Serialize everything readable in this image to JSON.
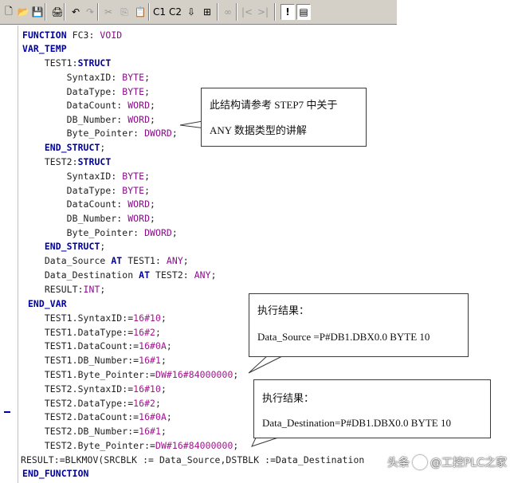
{
  "toolbar": {
    "buttons": [
      {
        "icon": "new-document-icon",
        "glyph": "🗋"
      },
      {
        "icon": "open-folder-icon",
        "glyph": "📂"
      },
      {
        "icon": "save-icon",
        "glyph": "💾"
      },
      {
        "icon": "print-icon",
        "glyph": "🖨"
      },
      {
        "icon": "undo-icon",
        "glyph": "↶"
      },
      {
        "icon": "redo-icon",
        "glyph": "↷"
      },
      {
        "icon": "cut-icon",
        "glyph": "✂"
      },
      {
        "icon": "copy-icon",
        "glyph": "⎘"
      },
      {
        "icon": "paste-icon",
        "glyph": "📋"
      },
      {
        "icon": "compile-icon",
        "glyph": "C1"
      },
      {
        "icon": "compile-all-icon",
        "glyph": "C2"
      },
      {
        "icon": "download-icon",
        "glyph": "⇩"
      },
      {
        "icon": "monitor-icon",
        "glyph": "⊞"
      },
      {
        "icon": "breakpoint-icon",
        "glyph": "∞"
      },
      {
        "icon": "previous-icon",
        "glyph": "|<"
      },
      {
        "icon": "next-icon",
        "glyph": ">|"
      },
      {
        "icon": "exclamation-icon",
        "glyph": "!"
      },
      {
        "icon": "window-icon",
        "glyph": "▤"
      }
    ]
  },
  "code_lines": [
    [
      {
        "t": "FUNCTION",
        "c": "kw"
      },
      {
        "t": " FC3: ",
        "c": "pl"
      },
      {
        "t": "VOID",
        "c": "ty"
      }
    ],
    [
      {
        "t": "VAR_TEMP",
        "c": "kw"
      }
    ],
    [
      {
        "t": "    TEST1:",
        "c": "pl"
      },
      {
        "t": "STRUCT",
        "c": "kw"
      }
    ],
    [
      {
        "t": "        SyntaxID: ",
        "c": "pl"
      },
      {
        "t": "BYTE",
        "c": "ty"
      },
      {
        "t": ";",
        "c": "pl"
      }
    ],
    [
      {
        "t": "        DataType: ",
        "c": "pl"
      },
      {
        "t": "BYTE",
        "c": "ty"
      },
      {
        "t": ";",
        "c": "pl"
      }
    ],
    [
      {
        "t": "        DataCount: ",
        "c": "pl"
      },
      {
        "t": "WORD",
        "c": "ty"
      },
      {
        "t": ";",
        "c": "pl"
      }
    ],
    [
      {
        "t": "        DB_Number: ",
        "c": "pl"
      },
      {
        "t": "WORD",
        "c": "ty"
      },
      {
        "t": ";",
        "c": "pl"
      }
    ],
    [
      {
        "t": "        Byte_Pointer: ",
        "c": "pl"
      },
      {
        "t": "DWORD",
        "c": "ty"
      },
      {
        "t": ";",
        "c": "pl"
      }
    ],
    [
      {
        "t": "    END_STRUCT",
        "c": "kw"
      },
      {
        "t": ";",
        "c": "pl"
      }
    ],
    [
      {
        "t": "    TEST2:",
        "c": "pl"
      },
      {
        "t": "STRUCT",
        "c": "kw"
      }
    ],
    [
      {
        "t": "        SyntaxID: ",
        "c": "pl"
      },
      {
        "t": "BYTE",
        "c": "ty"
      },
      {
        "t": ";",
        "c": "pl"
      }
    ],
    [
      {
        "t": "        DataType: ",
        "c": "pl"
      },
      {
        "t": "BYTE",
        "c": "ty"
      },
      {
        "t": ";",
        "c": "pl"
      }
    ],
    [
      {
        "t": "        DataCount: ",
        "c": "pl"
      },
      {
        "t": "WORD",
        "c": "ty"
      },
      {
        "t": ";",
        "c": "pl"
      }
    ],
    [
      {
        "t": "        DB_Number: ",
        "c": "pl"
      },
      {
        "t": "WORD",
        "c": "ty"
      },
      {
        "t": ";",
        "c": "pl"
      }
    ],
    [
      {
        "t": "        Byte_Pointer: ",
        "c": "pl"
      },
      {
        "t": "DWORD",
        "c": "ty"
      },
      {
        "t": ";",
        "c": "pl"
      }
    ],
    [
      {
        "t": "    END_STRUCT",
        "c": "kw"
      },
      {
        "t": ";",
        "c": "pl"
      }
    ],
    [
      {
        "t": "    Data_Source ",
        "c": "pl"
      },
      {
        "t": "AT",
        "c": "kw"
      },
      {
        "t": " TEST1: ",
        "c": "pl"
      },
      {
        "t": "ANY",
        "c": "ty"
      },
      {
        "t": ";",
        "c": "pl"
      }
    ],
    [
      {
        "t": "    Data_Destination ",
        "c": "pl"
      },
      {
        "t": "AT",
        "c": "kw"
      },
      {
        "t": " TEST2: ",
        "c": "pl"
      },
      {
        "t": "ANY",
        "c": "ty"
      },
      {
        "t": ";",
        "c": "pl"
      }
    ],
    [
      {
        "t": "    RESULT:",
        "c": "pl"
      },
      {
        "t": "INT",
        "c": "ty"
      },
      {
        "t": ";",
        "c": "pl"
      }
    ],
    [
      {
        "t": " END_VAR",
        "c": "kw"
      }
    ],
    [
      {
        "t": "    TEST1.SyntaxID:=",
        "c": "pl"
      },
      {
        "t": "16#10",
        "c": "lit"
      },
      {
        "t": ";",
        "c": "pl"
      }
    ],
    [
      {
        "t": "    TEST1.DataType:=",
        "c": "pl"
      },
      {
        "t": "16#2",
        "c": "lit"
      },
      {
        "t": ";",
        "c": "pl"
      }
    ],
    [
      {
        "t": "    TEST1.DataCount:=",
        "c": "pl"
      },
      {
        "t": "16#0A",
        "c": "lit"
      },
      {
        "t": ";",
        "c": "pl"
      }
    ],
    [
      {
        "t": "    TEST1.DB_Number:=",
        "c": "pl"
      },
      {
        "t": "16#1",
        "c": "lit"
      },
      {
        "t": ";",
        "c": "pl"
      }
    ],
    [
      {
        "t": "    TEST1.Byte_Pointer:=",
        "c": "pl"
      },
      {
        "t": "DW#16#84000000",
        "c": "lit"
      },
      {
        "t": ";",
        "c": "pl"
      }
    ],
    [
      {
        "t": "    TEST2.SyntaxID:=",
        "c": "pl"
      },
      {
        "t": "16#10",
        "c": "lit"
      },
      {
        "t": ";",
        "c": "pl"
      }
    ],
    [
      {
        "t": "    TEST2.DataType:=",
        "c": "pl"
      },
      {
        "t": "16#2",
        "c": "lit"
      },
      {
        "t": ";",
        "c": "pl"
      }
    ],
    [
      {
        "t": "    TEST2.DataCount:=",
        "c": "pl"
      },
      {
        "t": "16#0A",
        "c": "lit"
      },
      {
        "t": ";",
        "c": "pl"
      }
    ],
    [
      {
        "t": "    TEST2.DB_Number:=",
        "c": "pl"
      },
      {
        "t": "16#1",
        "c": "lit"
      },
      {
        "t": ";",
        "c": "pl"
      }
    ],
    [
      {
        "t": "    TEST2.Byte_Pointer:=",
        "c": "pl"
      },
      {
        "t": "DW#16#84000000",
        "c": "lit"
      },
      {
        "t": ";",
        "c": "pl"
      }
    ],
    [
      {
        "t": "RESULT:=BLKMOV(SRCBLK := Data_Source,DSTBLK :=Data_Destination",
        "c": "pl"
      }
    ],
    [
      {
        "t": "END_FUNCTION",
        "c": "kw"
      }
    ]
  ],
  "callouts": {
    "any_type": {
      "line1": "此结构请参考 STEP7 中关于",
      "line2": "ANY 数据类型的讲解"
    },
    "source_result": {
      "line1": "执行结果：",
      "line2": "Data_Source =P#DB1.DBX0.0 BYTE 10"
    },
    "destination_result": {
      "line1": "执行结果：",
      "line2": "Data_Destination=P#DB1.DBX0.0 BYTE 10"
    }
  },
  "watermark": {
    "prefix": "头条",
    "name": "@工控PLC之家"
  }
}
